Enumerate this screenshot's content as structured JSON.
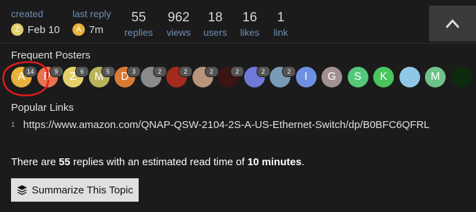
{
  "stats": {
    "created_label": "created",
    "created_value": "Feb 10",
    "created_avatar": "Z",
    "last_reply_label": "last reply",
    "last_reply_value": "7m",
    "last_reply_avatar": "A",
    "replies_value": "55",
    "replies_label": "replies",
    "views_value": "962",
    "views_label": "views",
    "users_value": "18",
    "users_label": "users",
    "likes_value": "16",
    "likes_label": "likes",
    "link_value": "1",
    "link_label": "link"
  },
  "frequent_posters": {
    "title": "Frequent Posters",
    "avatars": [
      {
        "letter": "A",
        "badge": "14",
        "color": "#e8b33c"
      },
      {
        "letter": "P",
        "badge": "9",
        "color": "#e8734c"
      },
      {
        "letter": "Z",
        "badge": "6",
        "color": "#e3d06a"
      },
      {
        "letter": "M",
        "badge": "5",
        "color": "#b9b35a"
      },
      {
        "letter": "D",
        "badge": "3",
        "color": "#d97b35"
      },
      {
        "letter": "",
        "badge": "2",
        "color": "#8a8a8a"
      },
      {
        "letter": "",
        "badge": "2",
        "color": "#a32a1d"
      },
      {
        "letter": "",
        "badge": "2",
        "color": "#b9957c"
      },
      {
        "letter": "",
        "badge": "2",
        "color": "#3b1512"
      },
      {
        "letter": "",
        "badge": "2",
        "color": "#6f79d8"
      },
      {
        "letter": "",
        "badge": "2",
        "color": "#7a9bb8"
      },
      {
        "letter": "I",
        "badge": "",
        "color": "#6f8fe0"
      },
      {
        "letter": "G",
        "badge": "",
        "color": "#a39191"
      },
      {
        "letter": "S",
        "badge": "",
        "color": "#55c77a"
      },
      {
        "letter": "K",
        "badge": "",
        "color": "#4bc45f"
      },
      {
        "letter": "",
        "badge": "",
        "color": "#8fc7e8"
      },
      {
        "letter": "M",
        "badge": "",
        "color": "#6fc28a"
      },
      {
        "letter": "",
        "badge": "",
        "color": "#0d2b0d"
      }
    ]
  },
  "popular_links": {
    "title": "Popular Links",
    "count": "1",
    "url": "https://www.amazon.com/QNAP-QSW-2104-2S-A-US-Ethernet-Switch/dp/B0BFC6QFRL"
  },
  "summary": {
    "prefix": "There are ",
    "replies": "55",
    "middle": " replies with an estimated read time of ",
    "read_time": "10 minutes",
    "suffix": "."
  },
  "summarize_button": {
    "label": "Summarize This Topic"
  }
}
